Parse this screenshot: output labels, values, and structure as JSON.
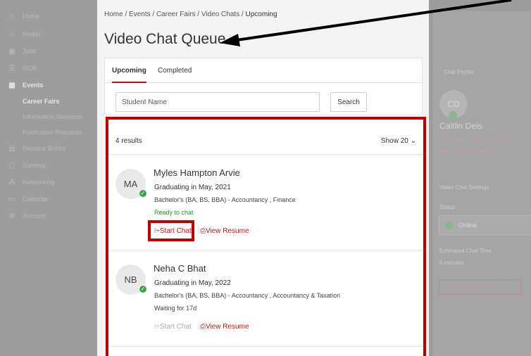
{
  "sidebar": {
    "items": [
      {
        "label": "Home",
        "icon": "home-icon",
        "glyph": "⌂"
      },
      {
        "label": "Profile",
        "icon": "profile-icon",
        "glyph": "☺"
      },
      {
        "label": "Jobs",
        "icon": "briefcase-icon",
        "glyph": "▣"
      },
      {
        "label": "OCR",
        "icon": "ocr-icon",
        "glyph": "☰"
      },
      {
        "label": "Events",
        "icon": "calendar-icon",
        "glyph": "▦"
      },
      {
        "label": "Career Fairs",
        "icon": "",
        "glyph": ""
      },
      {
        "label": "Information Sessions",
        "icon": "",
        "glyph": ""
      },
      {
        "label": "Publication Requests",
        "icon": "",
        "glyph": ""
      },
      {
        "label": "Resume Books",
        "icon": "book-icon",
        "glyph": "▤"
      },
      {
        "label": "Surveys",
        "icon": "survey-icon",
        "glyph": "▢"
      },
      {
        "label": "Networking",
        "icon": "network-icon",
        "glyph": "⁂"
      },
      {
        "label": "Calendar",
        "icon": "calendar-icon",
        "glyph": "▭"
      },
      {
        "label": "Account",
        "icon": "gear-icon",
        "glyph": "⚙"
      }
    ]
  },
  "breadcrumb": {
    "home": "Home",
    "events": "Events",
    "career_fairs": "Career Fairs",
    "video_chats": "Video Chats",
    "current": "Upcoming",
    "sep": " / "
  },
  "page_title": "Video Chat Queue",
  "tabs": {
    "upcoming": "Upcoming",
    "completed": "Completed"
  },
  "search": {
    "placeholder": "Student Name",
    "button": "Search"
  },
  "results": {
    "count": "4 results",
    "show": "Show  20 ⌄"
  },
  "students": [
    {
      "initials": "MA",
      "name": "Myles Hampton Arvie",
      "graduation": "Graduating in May, 2021",
      "degree": "Bachelor's (BA, BS, BBA) - Accountancy , Finance",
      "status": "Ready to chat",
      "start_chat": "⌲Start Chat",
      "view_resume": "⎙View Resume"
    },
    {
      "initials": "NB",
      "name": "Neha C Bhat",
      "graduation": "Graduating in May, 2022",
      "degree": "Bachelor's (BA, BS, BBA) - Accountancy , Accountancy & Taxation",
      "status": "Waiting for 17d",
      "start_chat": "⌲Start Chat",
      "view_resume": "⎙View Resume"
    }
  ],
  "right_panel": {
    "chat_profile_label": "Chat Profile",
    "initials": "CD",
    "name": "Caitlin Deis",
    "title": "Assistant Director, Employer De",
    "email": "deis.caitlin@gmail.com",
    "settings_label": "Video Chat Settings",
    "status_label": "Status",
    "status_value": "Online",
    "est_time_label": "Estimated Chat Time",
    "est_time_value": "5 minutes",
    "instructions_button": "Video Chat Instructions"
  },
  "colors": {
    "accent": "#c0111f",
    "highlight_box": "#c00000",
    "ready": "#2e8b3a",
    "online_badge": "#3aa34a"
  }
}
